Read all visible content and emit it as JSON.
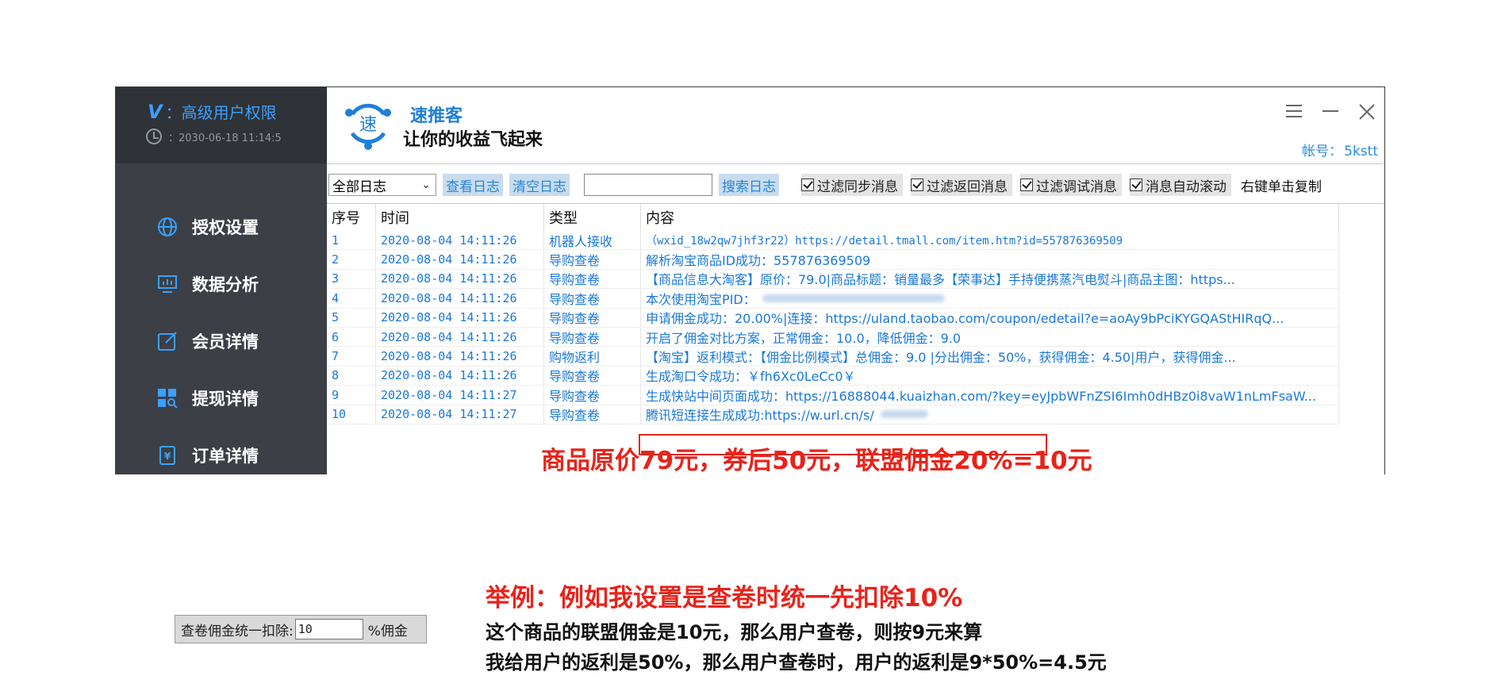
{
  "sidebar": {
    "vip_logo": "V",
    "permission": "：高级用户权限",
    "expire_time": "：2030-06-18 11:14:5",
    "items": [
      {
        "label": "授权设置",
        "icon": "globe-icon"
      },
      {
        "label": "数据分析",
        "icon": "chart-icon"
      },
      {
        "label": "会员详情",
        "icon": "edit-icon"
      },
      {
        "label": "提现详情",
        "icon": "grid-search-icon"
      },
      {
        "label": "订单详情",
        "icon": "receipt-icon"
      }
    ]
  },
  "header": {
    "brand_name": "速推客",
    "slogan": "让你的收益飞起来",
    "logo_char": "速",
    "account_label": "帐号：",
    "account_value": "5kstt",
    "brand_color": "#1e7fd8"
  },
  "toolbar": {
    "log_filter": "全部日志",
    "view_log": "查看日志",
    "clear_log": "清空日志",
    "search_value": "",
    "search_log": "搜索日志",
    "filters": [
      "过滤同步消息",
      "过滤返回消息",
      "过滤调试消息",
      "消息自动滚动"
    ],
    "copy_hint": "右键单击复制"
  },
  "table": {
    "headers": [
      "序号",
      "时间",
      "类型",
      "内容"
    ],
    "rows": [
      {
        "no": "1",
        "time": "2020-08-04 14:11:26",
        "type": "机器人接收",
        "content": "（wxid_18w2qw7jhf3r22）https://detail.tmall.com/item.htm?id=557876369509"
      },
      {
        "no": "2",
        "time": "2020-08-04 14:11:26",
        "type": "导购查卷",
        "content": "解析淘宝商品ID成功：557876369509"
      },
      {
        "no": "3",
        "time": "2020-08-04 14:11:26",
        "type": "导购查卷",
        "content": "【商品信息大淘客】原价：79.0|商品标题：销量最多【荣事达】手持便携蒸汽电熨斗|商品主图：https..."
      },
      {
        "no": "4",
        "time": "2020-08-04 14:11:26",
        "type": "导购查卷",
        "content": "本次使用淘宝PID："
      },
      {
        "no": "5",
        "time": "2020-08-04 14:11:26",
        "type": "导购查卷",
        "content": "申请佣金成功：20.00%|连接：https://uland.taobao.com/coupon/edetail?e=aoAy9bPciKYGQAStHIRqQ..."
      },
      {
        "no": "6",
        "time": "2020-08-04 14:11:26",
        "type": "导购查卷",
        "content": "开启了佣金对比方案，正常佣金：10.0，降低佣金：9.0"
      },
      {
        "no": "7",
        "time": "2020-08-04 14:11:26",
        "type": "购物返利",
        "content": "【淘宝】返利模式：【佣金比例模式】总佣金：9.0 |分出佣金：50%，获得佣金：4.50|用户，获得佣金..."
      },
      {
        "no": "8",
        "time": "2020-08-04 14:11:26",
        "type": "导购查卷",
        "content": "生成淘口令成功：￥fh6Xc0LeCc0￥"
      },
      {
        "no": "9",
        "time": "2020-08-04 14:11:27",
        "type": "导购查卷",
        "content": "生成快站中间页面成功：https://16888044.kuaizhan.com/?key=eyJpbWFnZSI6Imh0dHBz0i8vaW1nLmFsaW..."
      },
      {
        "no": "10",
        "time": "2020-08-04 14:11:27",
        "type": "导购查卷",
        "content": "腾讯短连接生成成功:https://w.url.cn/s/"
      }
    ]
  },
  "annotations": {
    "price_note": "商品原价79元，券后50元，联盟佣金20%=10元",
    "example_title": "举例：例如我设置是查卷时统一先扣除10%",
    "example_line1": "这个商品的联盟佣金是10元，那么用户查卷，则按9元来算",
    "example_line2": "我给用户的返利是50%，那么用户查卷时，用户的返利是9*50%=4.5元",
    "highlight_color": "#e0261d"
  },
  "deduct_setting": {
    "label": "查卷佣金统一扣除:",
    "value": "10",
    "unit": "%佣金"
  }
}
